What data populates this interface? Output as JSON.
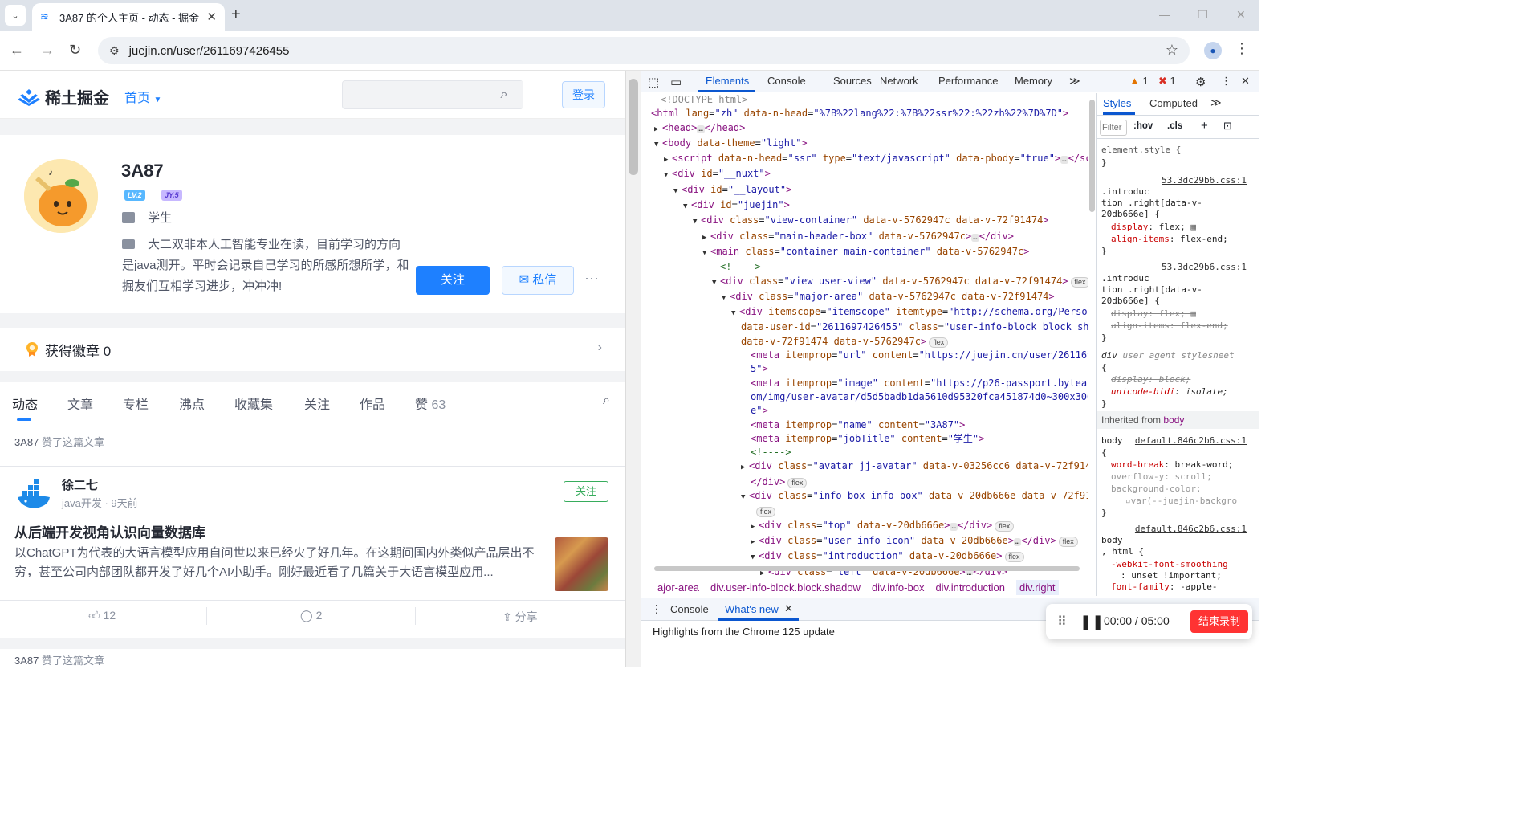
{
  "browser": {
    "tab_title": "3A87 的个人主页 - 动态 - 掘金",
    "url": "juejin.cn/user/2611697426455"
  },
  "juejin": {
    "logo_text": "稀土掘金",
    "nav_home": "首页",
    "login": "登录",
    "profile": {
      "name": "3A87",
      "level_badge": "LV.2",
      "jy_badge": "JY.5",
      "job": "学生",
      "intro": "大二双非本人工智能专业在读，目前学习的方向是java测开。平时会记录自己学习的所感所想所学，和掘友们互相学习进步，冲冲冲!",
      "follow": "关注",
      "message": "私信",
      "more": "···"
    },
    "badges_label": "获得徽章 0",
    "tabs": [
      "动态",
      "文章",
      "专栏",
      "沸点",
      "收藏集",
      "关注",
      "作品",
      "赞"
    ],
    "likes_count": "63",
    "liked_prefix": "3A87",
    "liked_suffix": "赞了这篇文章",
    "post": {
      "author": "徐二七",
      "meta": "java开发 · 9天前",
      "follow": "关注",
      "title": "从后端开发视角认识向量数据库",
      "body": "以ChatGPT为代表的大语言模型应用自问世以来已经火了好几年。在这期间国内外类似产品层出不穷，甚至公司内部团队都开发了好几个AI小助手。刚好最近看了几篇关于大语言模型应用...",
      "likes": "12",
      "comments": "2",
      "share": "分享"
    }
  },
  "devtools": {
    "tabs": [
      "Elements",
      "Console",
      "Sources",
      "Network",
      "Performance",
      "Memory"
    ],
    "warn_count": "1",
    "error_count": "1",
    "breadcrumbs": [
      "ajor-area",
      "div.user-info-block.block.shadow",
      "div.info-box",
      "div.introduction",
      "div.right"
    ],
    "styles_tabs": [
      "Styles",
      "Computed"
    ],
    "filter_placeholder": "Filter",
    "hov": ":hov",
    "cls": ".cls",
    "drawer_tabs": [
      "Console",
      "What's new"
    ],
    "whats_new": "Highlights from the Chrome 125 update",
    "inherited_label": "Inherited from",
    "inherited_el": "body"
  },
  "recorder": {
    "time": "00:00 / 05:00",
    "stop": "结束录制"
  }
}
